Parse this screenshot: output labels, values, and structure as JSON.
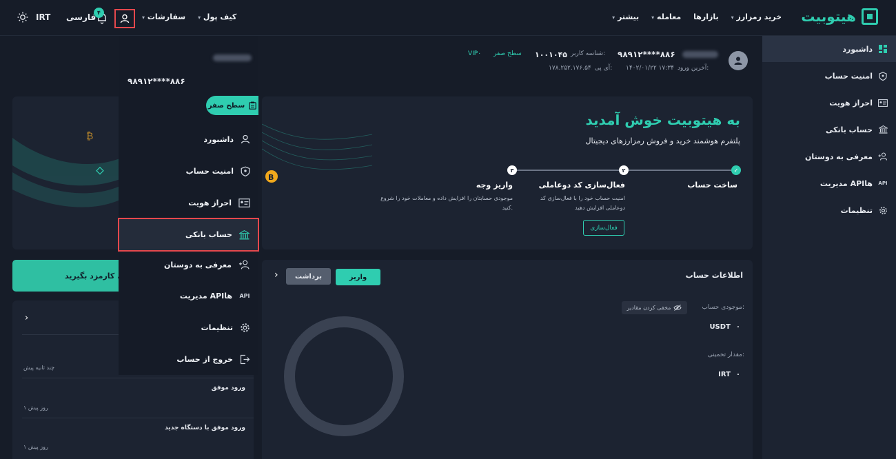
{
  "header": {
    "logo_text": "هیتوبیت",
    "nav": [
      {
        "label": "خرید رمزارز",
        "caret": true
      },
      {
        "label": "بازارها",
        "caret": false
      },
      {
        "label": "معامله",
        "caret": true
      },
      {
        "label": "بیشتر",
        "caret": true
      }
    ],
    "wallet_label": "کیف پول",
    "orders_label": "سفارشات",
    "notification_count": "۴",
    "language": "فارسی",
    "currency": "IRT"
  },
  "sidebar": {
    "items": [
      {
        "label": "داشبورد",
        "icon": "dashboard-icon",
        "active": true
      },
      {
        "label": "امنیت حساب",
        "icon": "shield-icon"
      },
      {
        "label": "احراز هویت",
        "icon": "id-card-icon"
      },
      {
        "label": "حساب بانکی",
        "icon": "bank-icon"
      },
      {
        "label": "معرفی به دوستان",
        "icon": "user-plus-icon"
      },
      {
        "label": "مدیریت APIها",
        "icon": "api-icon"
      },
      {
        "label": "تنظیمات",
        "icon": "gear-icon"
      }
    ]
  },
  "profile": {
    "phone": "۹۸۹۱۲****۸۸۶",
    "user_id_label": "شناسه کاربر:",
    "user_id": "۱۰۰۱۰۴۵",
    "level": "سطح صفر",
    "vip": "VIP۰",
    "last_login_label": "آخرین ورود:",
    "last_login": "۱۴۰۲/۰۱/۲۲ ۱۷:۳۴",
    "ip_label": "آی پی:",
    "ip": "۱۷۸.۲۵۲.۱۷۶.۵۴"
  },
  "hero": {
    "title": "به هیتوبیت خوش آمدید",
    "subtitle": "پلتفرم هوشمند خرید و فروش رمزارزهای دیجیتال",
    "steps": [
      {
        "num": "",
        "title": "ساخت حساب",
        "desc": ""
      },
      {
        "num": "۲",
        "title": "فعال‌سازی کد دوعاملی",
        "desc": "امنیت حساب خود را با فعال‌سازی کد دوعاملی افزایش دهید",
        "button": "فعال‌سازی"
      },
      {
        "num": "۳",
        "title": "واریز وجه",
        "desc": "موجودی حسابتان را افزایش داده و معاملات خود را شروع کنید."
      }
    ]
  },
  "promo": {
    "text": "ن، کارمزد بگیرید!"
  },
  "activity": {
    "rows": [
      {
        "title": "",
        "time": "چند ثانیه پیش"
      },
      {
        "title": "ورود موفق",
        "time": "۱ روز پیش"
      },
      {
        "title": "ورود موفق با دستگاه جدید",
        "time": "۱ روز پیش"
      }
    ]
  },
  "account": {
    "title": "اطلاعات حساب",
    "deposit": "واریز",
    "withdraw": "برداشت",
    "balance_label": "موجودی حساب:",
    "hide_values": "مخفی کردن مقادیر",
    "balance_currency": "USDT",
    "balance_value": "۰",
    "estimate_label": "مقدار تخمینی:",
    "estimate_currency": "IRT",
    "estimate_value": "۰"
  },
  "dropdown": {
    "phone": "۹۸۹۱۲****۸۸۶",
    "level": "سطح صفر",
    "items": [
      {
        "label": "داشبورد",
        "icon": "user-icon"
      },
      {
        "label": "امنیت حساب",
        "icon": "shield-icon"
      },
      {
        "label": "احراز هویت",
        "icon": "id-card-icon"
      },
      {
        "label": "حساب بانکی",
        "icon": "bank-icon",
        "highlighted": true
      },
      {
        "label": "معرفی به دوستان",
        "icon": "user-plus-icon"
      },
      {
        "label": "مدیریت APIها",
        "icon": "api-icon"
      },
      {
        "label": "تنظیمات",
        "icon": "gear-icon"
      },
      {
        "label": "خروج از حساب",
        "icon": "logout-icon"
      }
    ]
  },
  "colors": {
    "accent": "#2fcdb0",
    "bg": "#161c28",
    "panel": "#1c2331",
    "highlight": "#e5484d"
  }
}
